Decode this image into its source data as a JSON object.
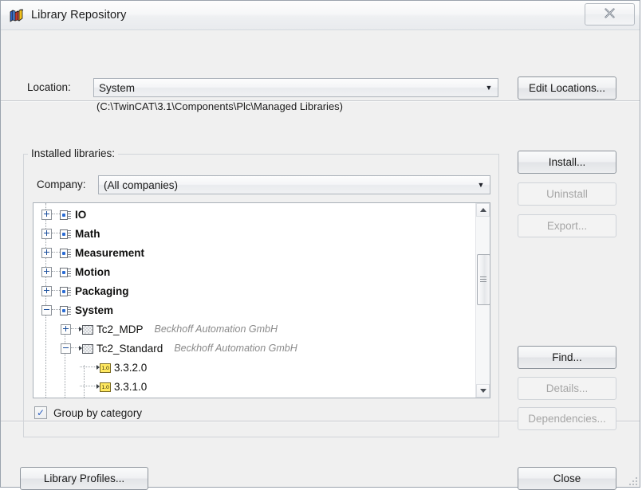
{
  "window": {
    "title": "Library Repository",
    "icon": "library-books-icon",
    "close_label": "✕"
  },
  "location": {
    "label": "Location:",
    "selected": "System",
    "path": "(C:\\TwinCAT\\3.1\\Components\\Plc\\Managed Libraries)",
    "edit_button": "Edit Locations..."
  },
  "installed": {
    "group_title": "Installed libraries:",
    "company_label": "Company:",
    "company_selected": "(All companies)",
    "group_by_category_label": "Group by category",
    "group_by_category_checked": true,
    "check_glyph": "✓"
  },
  "tree": {
    "nodes": [
      {
        "label": "IO",
        "vendor": "",
        "level": 0,
        "kind": "category",
        "state": "collapsed"
      },
      {
        "label": "Math",
        "vendor": "",
        "level": 0,
        "kind": "category",
        "state": "collapsed"
      },
      {
        "label": "Measurement",
        "vendor": "",
        "level": 0,
        "kind": "category",
        "state": "collapsed"
      },
      {
        "label": "Motion",
        "vendor": "",
        "level": 0,
        "kind": "category",
        "state": "collapsed"
      },
      {
        "label": "Packaging",
        "vendor": "",
        "level": 0,
        "kind": "category",
        "state": "collapsed"
      },
      {
        "label": "System",
        "vendor": "",
        "level": 0,
        "kind": "category",
        "state": "expanded"
      },
      {
        "label": "Tc2_MDP",
        "vendor": "Beckhoff Automation GmbH",
        "level": 1,
        "kind": "library",
        "state": "collapsed"
      },
      {
        "label": "Tc2_Standard",
        "vendor": "Beckhoff Automation GmbH",
        "level": 1,
        "kind": "library",
        "state": "expanded"
      },
      {
        "label": "3.3.2.0",
        "vendor": "",
        "level": 2,
        "kind": "version",
        "state": "leaf"
      },
      {
        "label": "3.3.1.0",
        "vendor": "",
        "level": 2,
        "kind": "version",
        "state": "leaf"
      }
    ],
    "version_icon_text": "1.0"
  },
  "buttons": {
    "install": "Install...",
    "uninstall": "Uninstall",
    "export": "Export...",
    "find": "Find...",
    "details": "Details...",
    "dependencies": "Dependencies...",
    "library_profiles": "Library Profiles...",
    "close": "Close"
  },
  "colors": {
    "dialog_bg": "#f0f0f0",
    "tree_bg": "#ffffff",
    "vendor_text": "#8a8a8a",
    "accent_blue": "#2b6cd4",
    "version_icon": "#ffe860"
  }
}
